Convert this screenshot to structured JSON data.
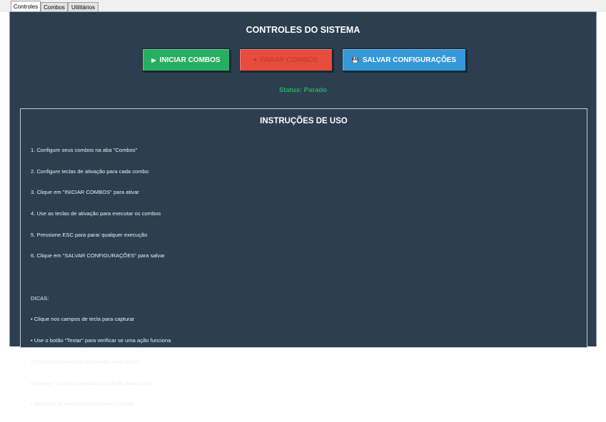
{
  "tabs": [
    {
      "label": "Controles",
      "active": true
    },
    {
      "label": "Combos",
      "active": false
    },
    {
      "label": "Utilitários",
      "active": false
    }
  ],
  "main": {
    "title": "CONTROLES DO SISTEMA",
    "buttons": {
      "start": {
        "icon": "play-icon",
        "glyph": "▶",
        "label": "INICIAR COMBOS",
        "color": "#27ae60"
      },
      "stop": {
        "icon": "stop-icon",
        "glyph": "⏹",
        "label": "PARAR COMBOS",
        "color": "#e74c3c"
      },
      "save": {
        "icon": "floppy-icon",
        "glyph": "💾",
        "label": "SALVAR CONFIGURAÇÕES",
        "color": "#3498db"
      }
    },
    "status": "Status: Parado",
    "status_color": "#27ae60"
  },
  "instructions": {
    "title": "INSTRUÇÕES DE USO",
    "lines": [
      "1. Configure seus combos na aba \"Combos\"",
      "2. Configure teclas de ativação para cada combo",
      "3. Clique em \"INICIAR COMBOS\" para ativar",
      "4. Use as teclas de ativação para executar os combos",
      "5. Pressione ESC para parar qualquer execução",
      "6. Clique em \"SALVAR CONFIGURAÇÕES\" para salvar",
      "",
      "DICAS:",
      "• Clique nos campos de tecla para capturar",
      "• Use o botão \"Testar\" para verificar se uma ação funciona",
      "• Configure intervalos adequados entre ações",
      "• Marque \"2x\" para executar uma ação duas vezes",
      "• Monitore as execuções no painel à direita"
    ]
  },
  "colors": {
    "background": "#2c3e50",
    "text": "#ffffff"
  }
}
